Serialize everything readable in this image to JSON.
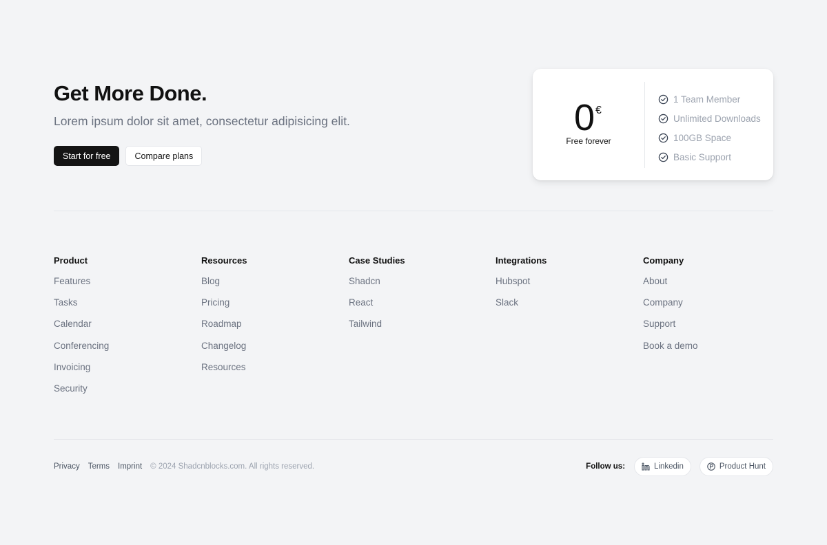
{
  "hero": {
    "title": "Get More Done.",
    "subtitle": "Lorem ipsum dolor sit amet, consectetur adipisicing elit.",
    "primary_button": "Start for free",
    "secondary_button": "Compare plans"
  },
  "pricing": {
    "amount": "0",
    "currency": "€",
    "caption": "Free forever",
    "features": [
      "1 Team Member",
      "Unlimited Downloads",
      "100GB Space",
      "Basic Support"
    ],
    "feature_icon": "check-circle-icon"
  },
  "columns": [
    {
      "heading": "Product",
      "links": [
        "Features",
        "Tasks",
        "Calendar",
        "Conferencing",
        "Invoicing",
        "Security"
      ]
    },
    {
      "heading": "Resources",
      "links": [
        "Blog",
        "Pricing",
        "Roadmap",
        "Changelog",
        "Resources"
      ]
    },
    {
      "heading": "Case Studies",
      "links": [
        "Shadcn",
        "React",
        "Tailwind"
      ]
    },
    {
      "heading": "Integrations",
      "links": [
        "Hubspot",
        "Slack"
      ]
    },
    {
      "heading": "Company",
      "links": [
        "About",
        "Company",
        "Support",
        "Book a demo"
      ]
    }
  ],
  "bottom": {
    "links": [
      "Privacy",
      "Terms",
      "Imprint"
    ],
    "copyright": "© 2024 Shadcnblocks.com. All rights reserved.",
    "follow_label": "Follow us:",
    "social": [
      {
        "label": "Linkedin",
        "icon": "linkedin-icon"
      },
      {
        "label": "Product Hunt",
        "icon": "product-hunt-icon"
      }
    ]
  },
  "colors": {
    "background": "#f3f4f6",
    "primary_button": "#141414",
    "muted_text": "#6b7280",
    "feature_text": "#9ca3af"
  }
}
